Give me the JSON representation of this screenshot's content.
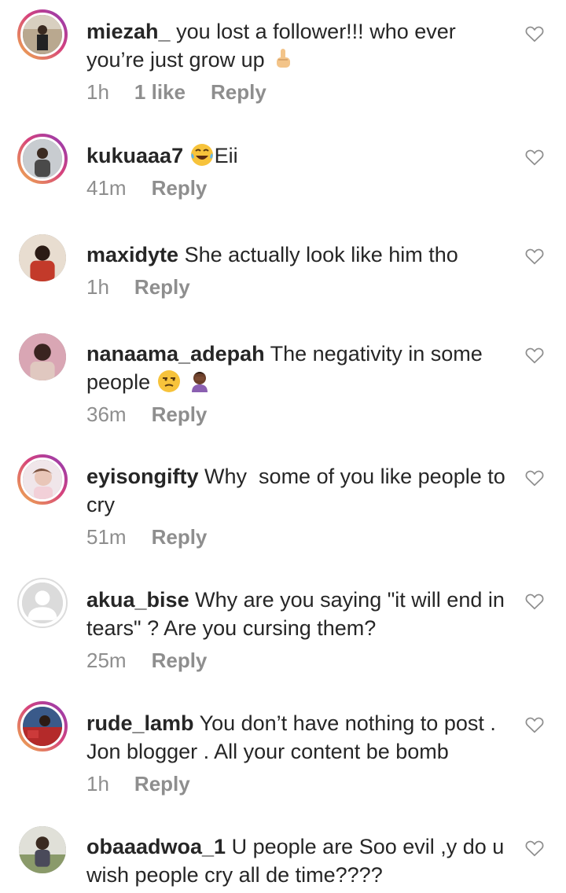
{
  "comments": [
    {
      "username": "miezah_",
      "text": "you lost a follower!!! who ever you’re just grow up",
      "emoji": "middle-finger-emoji",
      "time": "1h",
      "likes": "1 like",
      "reply": "Reply",
      "avatar_color": "#7a6a5a"
    },
    {
      "username": "kukuaaa7",
      "text": "Eii",
      "emoji_before": "tears-of-joy-emoji",
      "time": "41m",
      "likes": "",
      "reply": "Reply",
      "avatar_color": "#5a6a5a"
    },
    {
      "username": "maxidyte",
      "text": "She actually look like him tho",
      "time": "1h",
      "likes": "",
      "reply": "Reply",
      "avatar_color": "#c44a3a"
    },
    {
      "username": "nanaama_adepah",
      "text": "The negativity in some people",
      "emoji": "unamused-face-emoji",
      "emoji2": "person-facepalming-emoji",
      "time": "36m",
      "likes": "",
      "reply": "Reply",
      "avatar_color": "#8a5a6a"
    },
    {
      "username": "eyisongifty",
      "text": "Why  some of you like people to cry",
      "time": "51m",
      "likes": "",
      "reply": "Reply",
      "avatar_color": "#d9a8b0"
    },
    {
      "username": "akua_bise",
      "text": "Why are you saying \"it will end in tears\" ? Are you cursing them?",
      "time": "25m",
      "likes": "",
      "reply": "Reply",
      "avatar_color": "#dbdbdb"
    },
    {
      "username": "rude_lamb",
      "text": "You don’t have nothing to post . Jon blogger . All your content be bomb",
      "time": "1h",
      "likes": "",
      "reply": "Reply",
      "avatar_color": "#b43a3a"
    },
    {
      "username": "obaaadwoa_1",
      "text": "U people are Soo evil ,y do u wish people cry all de time????",
      "time": "",
      "likes": "",
      "reply": "",
      "avatar_color": "#6a7a5a"
    }
  ]
}
